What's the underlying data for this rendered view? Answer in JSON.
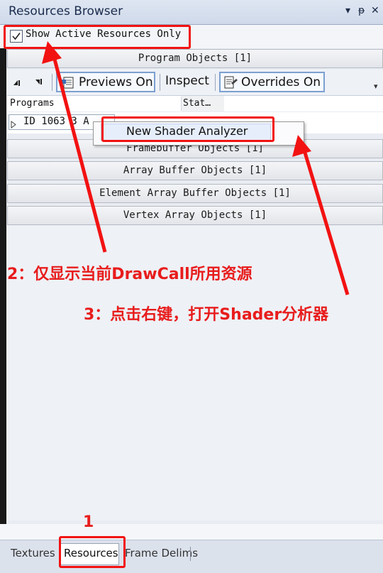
{
  "window": {
    "title": "Resources Browser",
    "controls": [
      "▾",
      "ᵽ",
      "✕"
    ]
  },
  "filter": {
    "show_active_label": "Show Active Resources Only",
    "checked": true
  },
  "sections": {
    "program_objects": "Program Objects [1]",
    "framebuffer_objects": "Framebuffer Objects [1]",
    "array_buffer_objects": "Array Buffer Objects [1]",
    "element_array_buffer_objects": "Element Array Buffer Objects [1]",
    "vertex_array_objects": "Vertex Array Objects [1]"
  },
  "toolbar": {
    "previews_label": "Previews On",
    "inspect_label": "Inspect",
    "overrides_label": "Overrides On",
    "more_glyph": "▾"
  },
  "table": {
    "columns": [
      "Programs",
      "Stat…"
    ],
    "rows": [
      {
        "label": "ID 1063  3 A"
      }
    ]
  },
  "context_menu": {
    "items": [
      "New Shader Analyzer"
    ]
  },
  "tabs": [
    "Textures",
    "Resources",
    "Frame Delims"
  ],
  "annotations": {
    "step1": "1",
    "step2": "2：仅显示当前DrawCall所用资源",
    "step3": "3：点击右键，打开Shader分析器"
  },
  "colors": {
    "annotation": "#f21212",
    "selected_border": "#7ca0cf"
  }
}
